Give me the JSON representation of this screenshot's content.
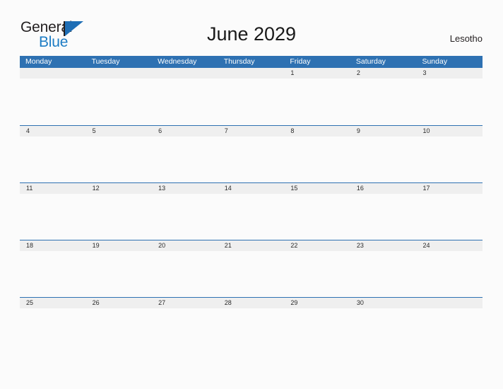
{
  "brand": {
    "name_part1": "General",
    "name_part2": "Blue",
    "logo_icon": "blue-triangle-icon"
  },
  "header": {
    "title": "June 2029",
    "country": "Lesotho"
  },
  "calendar": {
    "weekdays": [
      "Monday",
      "Tuesday",
      "Wednesday",
      "Thursday",
      "Friday",
      "Saturday",
      "Sunday"
    ],
    "weeks": [
      [
        "",
        "",
        "",
        "",
        "1",
        "2",
        "3"
      ],
      [
        "4",
        "5",
        "6",
        "7",
        "8",
        "9",
        "10"
      ],
      [
        "11",
        "12",
        "13",
        "14",
        "15",
        "16",
        "17"
      ],
      [
        "18",
        "19",
        "20",
        "21",
        "22",
        "23",
        "24"
      ],
      [
        "25",
        "26",
        "27",
        "28",
        "29",
        "30",
        ""
      ]
    ]
  },
  "colors": {
    "header_blue": "#2e71b2",
    "logo_blue": "#1d7cc4",
    "band_gray": "#efefef",
    "page_background": "#fbfbfb",
    "text_dark": "#231f20"
  }
}
